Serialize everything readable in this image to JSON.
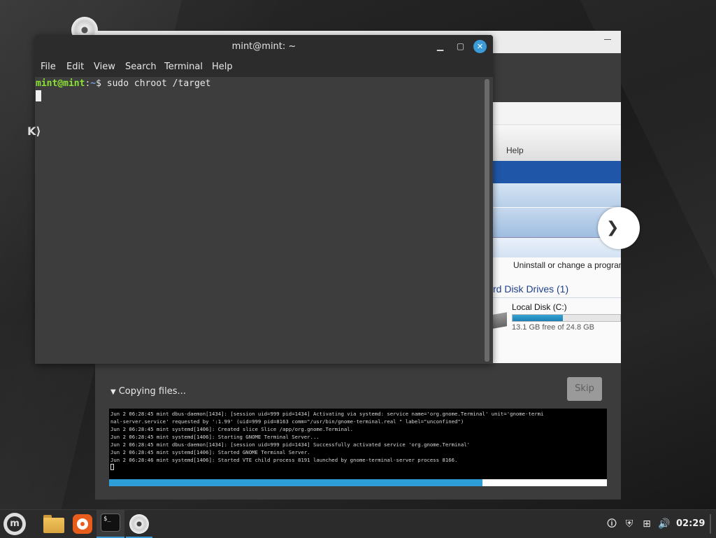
{
  "terminal": {
    "title": "mint@mint: ~",
    "menu": [
      "File",
      "Edit",
      "View",
      "Search",
      "Terminal",
      "Help"
    ],
    "prompt_user": "mint@mint",
    "prompt_sep": ":",
    "prompt_dir": "~",
    "prompt_symbol": "$ ",
    "command": "sudo chroot /target"
  },
  "installer": {
    "slide": {
      "help_label": "Help",
      "uninstall_label": "Uninstall or change a program",
      "hdd_heading": "rd Disk Drives (1)",
      "local_disk": "Local Disk (C:)",
      "free_space": "13.1 GB free of 24.8 GB",
      "disk_usage_fraction": 0.47
    },
    "copying_label": "Copying files...",
    "skip_label": "Skip",
    "log_lines": [
      "Jun  2 06:28:45 mint dbus-daemon[1434]: [session uid=999 pid=1434] Activating via systemd: service name='org.gnome.Terminal' unit='gnome-termi",
      "nal-server.service' requested by ':1.99' (uid=999 pid=8163 comm=\"/usr/bin/gnome-terminal.real \" label=\"unconfined\")",
      "Jun  2 06:28:45 mint systemd[1406]: Created slice Slice /app/org.gnome.Terminal.",
      "Jun  2 06:28:45 mint systemd[1406]: Starting GNOME Terminal Server...",
      "Jun  2 06:28:45 mint dbus-daemon[1434]: [session uid=999 pid=1434] Successfully activated service 'org.gnome.Terminal'",
      "Jun  2 06:28:45 mint systemd[1406]: Started GNOME Terminal Server.",
      "Jun  2 06:28:46 mint systemd[1406]: Started VTE child process 8191 launched by gnome-terminal-server process 8166."
    ],
    "progress_percent": 75
  },
  "taskbar": {
    "clock": "02:29",
    "icons": [
      "mint-menu-icon",
      "folder-icon",
      "firefox-icon",
      "terminal-icon",
      "disc-icon"
    ],
    "tray": [
      "update-icon",
      "shield-icon",
      "network-icon",
      "volume-icon"
    ],
    "terminal_task_glyph": "$_"
  },
  "colors": {
    "accent": "#3c9bd6",
    "prompt_user": "#8ae234",
    "prompt_dir": "#729fcf",
    "progress": "#2d9ed7"
  }
}
